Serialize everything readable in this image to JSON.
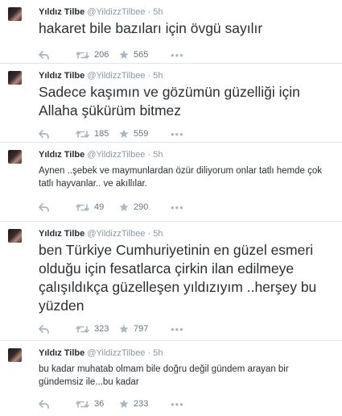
{
  "tweets": [
    {
      "name": "Yıldız Tilbe",
      "handle": "@YildizzTilbee",
      "time": "5h",
      "text": "hakaret bile bazıları için övgü sayılır",
      "retweets": "206",
      "favorites": "565",
      "size": "large"
    },
    {
      "name": "Yıldız Tilbe",
      "handle": "@YildizzTilbee",
      "time": "5h",
      "text": "Sadece kaşımın ve gözümün güzelliği için Allaha şükürüm bitmez",
      "retweets": "185",
      "favorites": "559",
      "size": "large"
    },
    {
      "name": "Yıldız Tilbe",
      "handle": "@YildizzTilbee",
      "time": "5h",
      "text": "Aynen ..şebek ve maymunlardan özür diliyorum onlar tatlı hemde çok tatlı hayvanlar.. ve akıllılar.",
      "retweets": "49",
      "favorites": "290",
      "size": "small"
    },
    {
      "name": "Yıldız Tilbe",
      "handle": "@YildizzTilbee",
      "time": "5h",
      "text": "ben Türkiye Cumhuriyetinin en güzel esmeri olduğu için fesatlarca çirkin ilan edilmeye çalışıldıkça güzelleşen yıldızıyım ..herşey bu yüzden",
      "retweets": "323",
      "favorites": "797",
      "size": "large"
    },
    {
      "name": "Yıldız Tilbe",
      "handle": "@YildizzTilbee",
      "time": "5h",
      "text": "bu kadar muhatab olmam bile doğru değil gündem arayan bir gündemsiz ile...bu kadar",
      "retweets": "36",
      "favorites": "233",
      "size": "small"
    }
  ],
  "icons": {
    "reply": "reply-icon",
    "retweet": "retweet-icon",
    "favorite": "star-icon",
    "more": "more-icon"
  },
  "colors": {
    "text": "#292f33",
    "muted": "#8899a6",
    "icon": "#aab8c2",
    "divider": "#e1e8ed"
  }
}
